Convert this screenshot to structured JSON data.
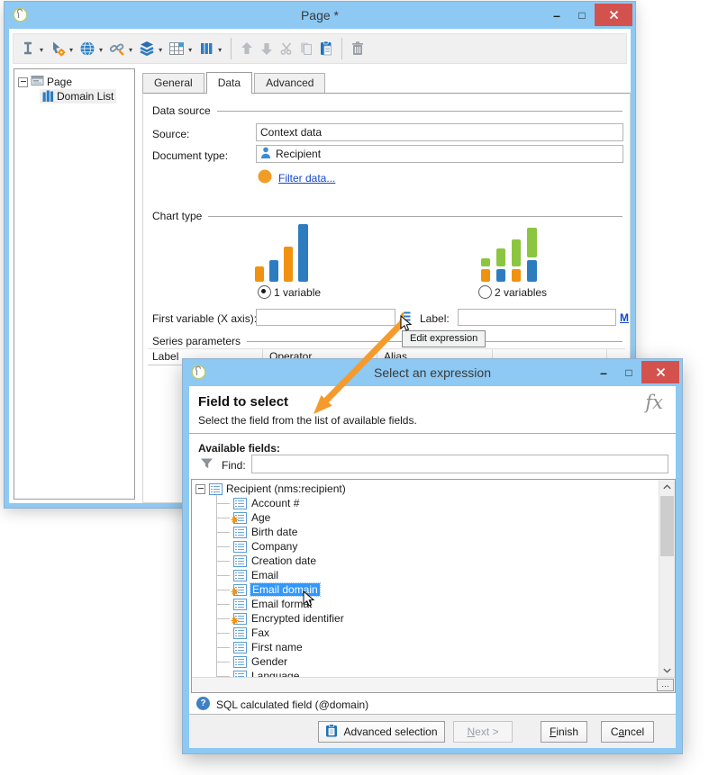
{
  "colors": {
    "titlebar_blue": "#8dc9f3",
    "close_red": "#d3524e",
    "link_blue": "#1447cc",
    "accent_orange": "#f59b2d",
    "chart_blue": "#2e7cc0",
    "chart_orange": "#f0920f",
    "chart_green": "#8cc540",
    "selection_blue": "#3297fd"
  },
  "icons": {
    "dropdown_caret": "▾",
    "minimize_glyph": "–",
    "maximize_glyph": "□"
  },
  "page_window": {
    "title": "Page *",
    "tree": {
      "root_label": "Page",
      "child_label": "Domain List"
    },
    "tabs": [
      "General",
      "Data",
      "Advanced"
    ],
    "active_tab": "Data",
    "data_source": {
      "header": "Data source",
      "source_label": "Source:",
      "source_value": "Context data",
      "document_type_label": "Document type:",
      "document_type_value": "Recipient",
      "filter_link": "Filter data..."
    },
    "chart_type": {
      "header": "Chart type",
      "option_1": "1 variable",
      "option_2": "2 variables"
    },
    "x_axis": {
      "label": "First variable (X axis):",
      "value": "",
      "edit_tooltip": "Edit expression",
      "label_label": "Label:",
      "label_value": "",
      "m_link": "M"
    },
    "series": {
      "header": "Series parameters",
      "columns": [
        "Label",
        "Operator",
        "Alias"
      ]
    }
  },
  "dialog": {
    "title": "Select an expression",
    "heading": "Field to select",
    "subheading": "Select the field from the list of available fields.",
    "fx_glyph": "fx",
    "available_fields_label": "Available fields:",
    "find_label": "Find:",
    "find_value": "",
    "root_item": "Recipient (nms:recipient)",
    "fields": [
      {
        "label": "Account #"
      },
      {
        "label": "Age"
      },
      {
        "label": "Birth date"
      },
      {
        "label": "Company"
      },
      {
        "label": "Creation date"
      },
      {
        "label": "Email"
      },
      {
        "label": "Email domain"
      },
      {
        "label": "Email format"
      },
      {
        "label": "Encrypted identifier"
      },
      {
        "label": "Fax"
      },
      {
        "label": "First name"
      },
      {
        "label": "Gender"
      },
      {
        "label": "Language"
      }
    ],
    "selected_field": "Email domain",
    "status_help_glyph": "?",
    "status_text": "SQL calculated field (@domain)",
    "ellipsis_button": "…",
    "buttons": {
      "advanced": "Advanced selection",
      "next": {
        "key": "N",
        "post": "ext >"
      },
      "finish": {
        "key": "F",
        "post": "inish"
      },
      "cancel": {
        "pre": "C",
        "key": "a",
        "post": "ncel"
      }
    }
  }
}
